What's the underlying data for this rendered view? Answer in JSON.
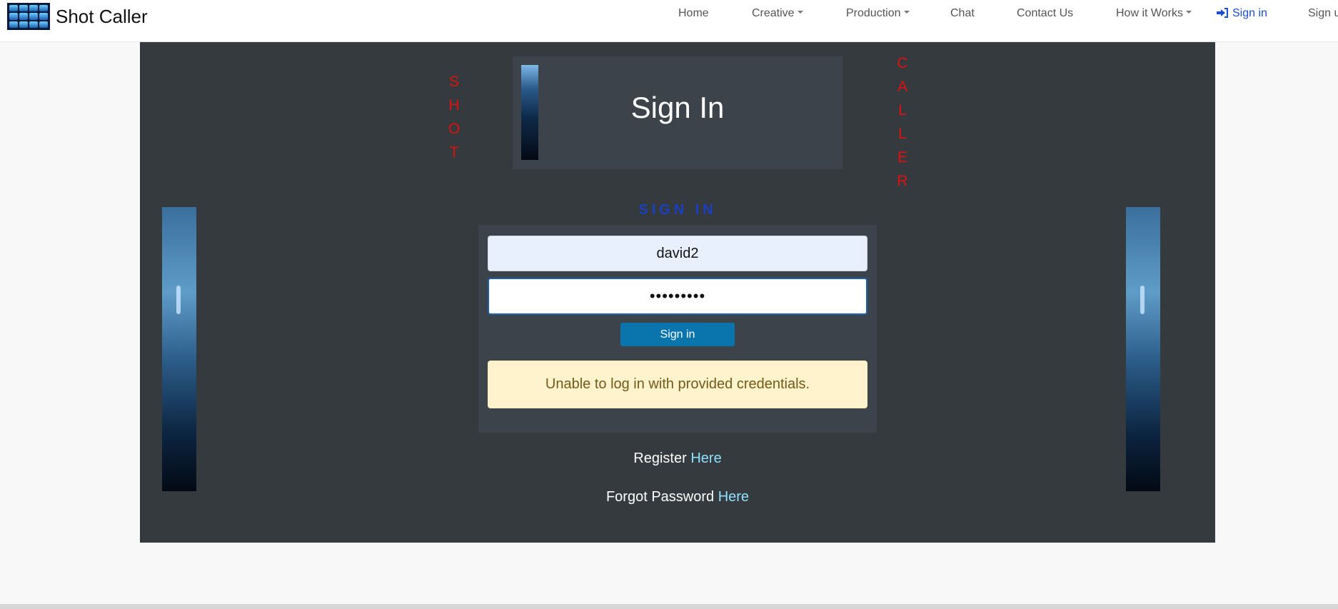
{
  "brand": {
    "name": "Shot Caller"
  },
  "nav": {
    "home": "Home",
    "creative": "Creative",
    "production": "Production",
    "chat": "Chat",
    "contact": "Contact Us",
    "how_it_works": "How it Works",
    "sign_in": "Sign in",
    "sign_up": "Sign up"
  },
  "banner": {
    "left_word": [
      "S",
      "H",
      "O",
      "T"
    ],
    "right_word": [
      "C",
      "A",
      "L",
      "L",
      "E",
      "R"
    ],
    "title": "Sign In"
  },
  "form": {
    "heading": "SIGN IN",
    "username_value": "david2",
    "password_value": "•••••••••",
    "submit_label": "Sign in",
    "error_message": "Unable to log in with provided credentials."
  },
  "links": {
    "register_text": "Register",
    "register_link": "Here",
    "forgot_text": "Forgot Password",
    "forgot_link": "Here"
  },
  "colors": {
    "accent_red": "#e01010",
    "heading_blue": "#1a3fc0",
    "button_blue": "#0a75ad",
    "link_cyan": "#8fe0ff",
    "panel_dark": "#343a3d"
  }
}
